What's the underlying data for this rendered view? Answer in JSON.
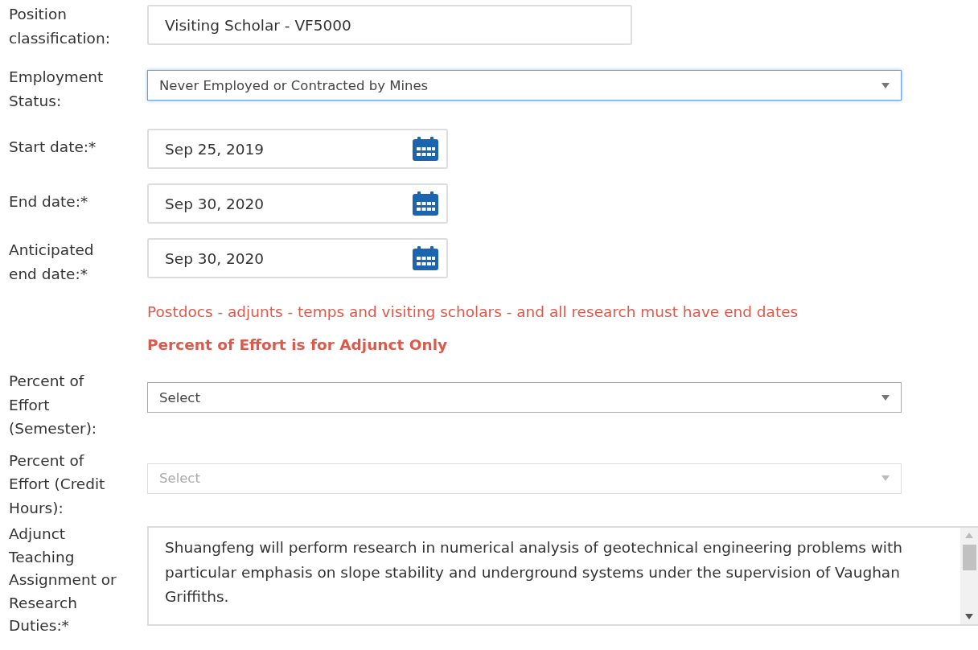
{
  "form": [
    {
      "kind": "text",
      "label": "Position classification:",
      "value": "Visiting Scholar - VF5000"
    },
    {
      "kind": "select",
      "label": "Employment Status:",
      "value": "Never Employed or Contracted by Mines",
      "focused": true,
      "disabled": false
    },
    {
      "kind": "date",
      "label": "Start date:*",
      "value": "Sep 25, 2019"
    },
    {
      "kind": "date",
      "label": "End date:*",
      "value": "Sep 30, 2020"
    },
    {
      "kind": "date",
      "label": "Anticipated end date:*",
      "value": "Sep 30, 2020"
    },
    {
      "kind": "note",
      "text": "Postdocs - adjunts - temps and visiting scholars - and all research must have end dates",
      "bold": false
    },
    {
      "kind": "note",
      "text": "Percent of Effort is for Adjunct Only",
      "bold": true
    },
    {
      "kind": "select",
      "label": "Percent of Effort (Semester):",
      "value": "Select",
      "focused": false,
      "disabled": false
    },
    {
      "kind": "select",
      "label": "Percent of Effort (Credit Hours):",
      "value": "Select",
      "focused": false,
      "disabled": true
    },
    {
      "kind": "textarea",
      "label": "Adjunct Teaching Assignment or Research Duties:*",
      "value": "Shuangfeng will perform research in numerical analysis of geotechnical engineering problems with particular emphasis on slope stability and underground systems under the supervision of Vaughan Griffiths."
    }
  ]
}
